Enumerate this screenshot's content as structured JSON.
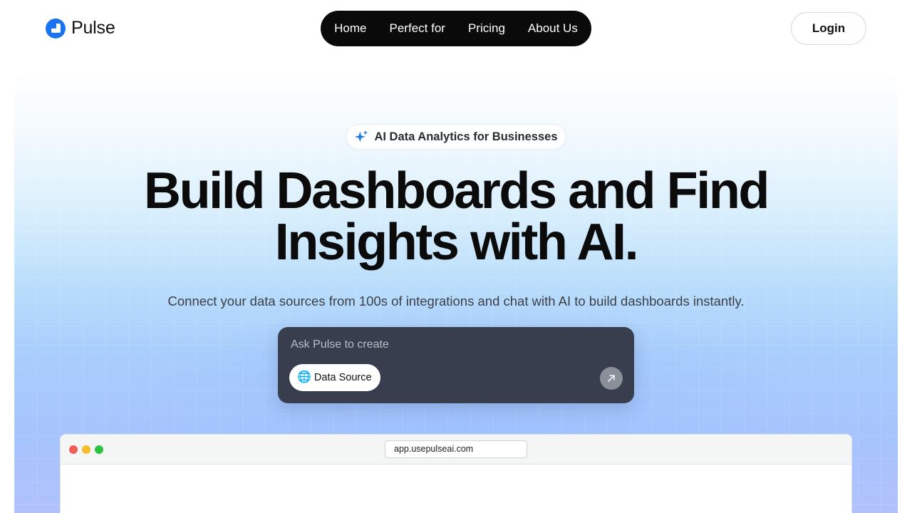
{
  "brand": {
    "name": "Pulse",
    "accent_color": "#1a73f0"
  },
  "nav": {
    "items": [
      {
        "label": "Home"
      },
      {
        "label": "Perfect for"
      },
      {
        "label": "Pricing"
      },
      {
        "label": "About Us"
      }
    ]
  },
  "header": {
    "login_label": "Login"
  },
  "hero": {
    "badge": {
      "icon": "sparkle-icon",
      "text": "AI Data Analytics for Businesses"
    },
    "headline_line1": "Build Dashboards and Find",
    "headline_line2": "Insights with AI.",
    "subtext": "Connect your data sources from 100s of integrations and chat with AI to build dashboards instantly.",
    "prompt": {
      "placeholder": "Ask Pulse to create",
      "chip_icon": "globe-icon",
      "chip_label": "Data Source",
      "send_icon": "arrow-up-right-icon"
    }
  },
  "browser_mockup": {
    "url": "app.usepulseai.com"
  }
}
